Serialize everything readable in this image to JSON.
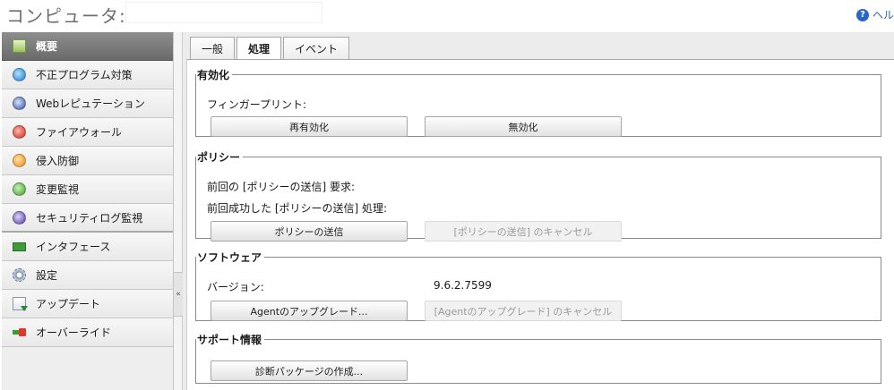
{
  "header": {
    "title": "コンピュータ:",
    "help_label": "ヘル"
  },
  "sidebar": {
    "items": [
      {
        "label": "概要",
        "icon": "summary-icon"
      },
      {
        "label": "不正プログラム対策",
        "icon": "anti-malware-icon"
      },
      {
        "label": "Webレピュテーション",
        "icon": "web-reputation-icon"
      },
      {
        "label": "ファイアウォール",
        "icon": "firewall-icon"
      },
      {
        "label": "侵入防御",
        "icon": "intrusion-prevention-icon"
      },
      {
        "label": "変更監視",
        "icon": "integrity-monitoring-icon"
      },
      {
        "label": "セキュリティログ監視",
        "icon": "log-inspection-icon"
      },
      {
        "label": "インタフェース",
        "icon": "interface-icon"
      },
      {
        "label": "設定",
        "icon": "gear-icon"
      },
      {
        "label": "アップデート",
        "icon": "update-icon"
      },
      {
        "label": "オーバーライド",
        "icon": "override-icon"
      }
    ],
    "collapse_label": "«"
  },
  "tabs": [
    {
      "label": "一般"
    },
    {
      "label": "処理"
    },
    {
      "label": "イベント"
    }
  ],
  "sections": {
    "activation": {
      "title": "有効化",
      "fingerprint_label": "フィンガープリント:",
      "reactivate_button": "再有効化",
      "deactivate_button": "無効化"
    },
    "policy": {
      "title": "ポリシー",
      "last_send_request_label": "前回の [ポリシーの送信] 要求:",
      "last_successful_send_label": "前回成功した [ポリシーの送信] 処理:",
      "send_policy_button": "ポリシーの送信",
      "cancel_send_policy_button": "[ポリシーの送信] のキャンセル"
    },
    "software": {
      "title": "ソフトウェア",
      "version_label": "バージョン:",
      "version_value": "9.6.2.7599",
      "upgrade_agent_button": "Agentのアップグレード...",
      "cancel_upgrade_button": "[Agentのアップグレード] のキャンセル"
    },
    "support": {
      "title": "サポート情報",
      "create_diagnostic_button": "診断パッケージの作成..."
    }
  }
}
